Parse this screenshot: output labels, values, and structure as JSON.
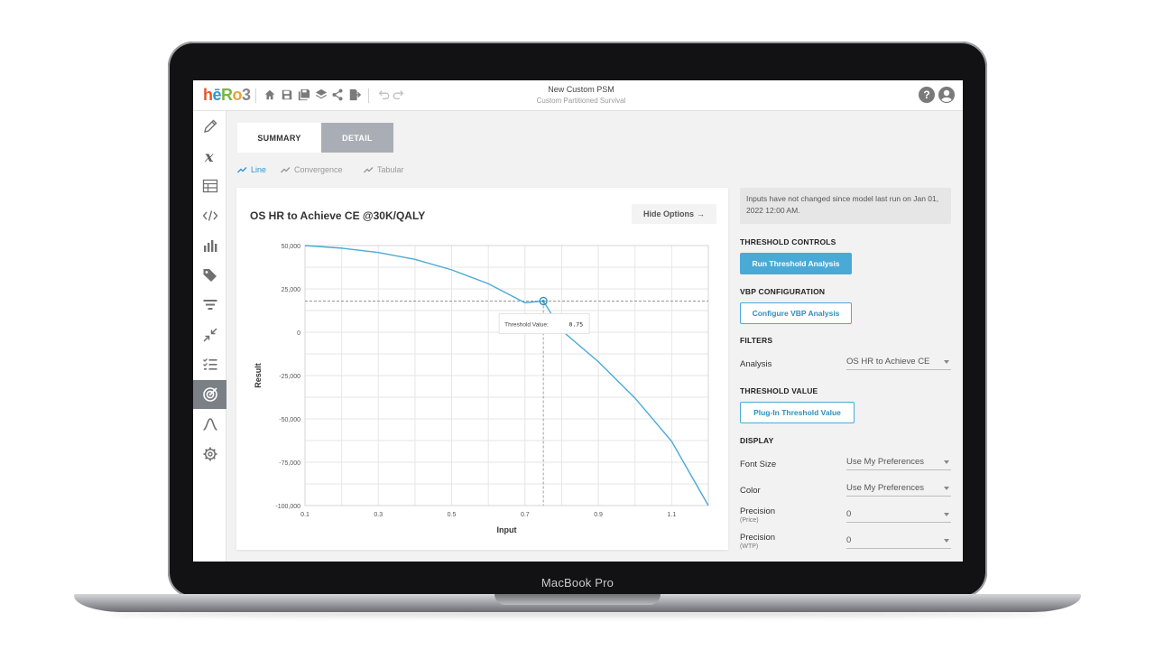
{
  "device": {
    "label": "MacBook Pro"
  },
  "app": {
    "logo": {
      "h": "h",
      "e": "ē",
      "r": "R",
      "o": "o",
      "three": "3"
    },
    "title": "New Custom PSM",
    "subtitle": "Custom Partitioned Survival",
    "toolbar_icons": [
      "home-icon",
      "save-icon",
      "save-as-icon",
      "layers-icon",
      "share-icon",
      "export-icon",
      "undo-icon",
      "redo-icon"
    ],
    "header_icons": [
      "help-icon",
      "user-icon"
    ],
    "help_glyph": "?"
  },
  "sidebar": {
    "items": [
      {
        "icon": "pencil-icon",
        "active": false
      },
      {
        "icon": "variable-x-icon",
        "active": false
      },
      {
        "icon": "table-icon",
        "active": false
      },
      {
        "icon": "code-icon",
        "active": false
      },
      {
        "icon": "bar-chart-icon",
        "active": false
      },
      {
        "icon": "tags-icon",
        "active": false
      },
      {
        "icon": "filter-icon",
        "active": false
      },
      {
        "icon": "compress-icon",
        "active": false
      },
      {
        "icon": "checklist-icon",
        "active": false
      },
      {
        "icon": "target-icon",
        "active": true
      },
      {
        "icon": "curve-icon",
        "active": false
      },
      {
        "icon": "gear-icon",
        "active": false
      }
    ]
  },
  "tabs": {
    "summary": "SUMMARY",
    "detail": "DETAIL",
    "active": "summary"
  },
  "subtabs": [
    {
      "label": "Line",
      "active": true
    },
    {
      "label": "Convergence",
      "active": false
    },
    {
      "label": "Tabular",
      "active": false
    }
  ],
  "card": {
    "title": "OS HR to Achieve CE @30K/QALY",
    "hide_options": "Hide Options",
    "hide_arrow": "→"
  },
  "chart_data": {
    "type": "line",
    "title": "OS HR to Achieve CE @30K/QALY",
    "xlabel": "Input",
    "ylabel": "Result",
    "xlim": [
      0.1,
      1.2
    ],
    "ylim": [
      -100000,
      50000
    ],
    "x_ticks": [
      0.1,
      0.3,
      0.5,
      0.7,
      0.9,
      1.1
    ],
    "x_tick_labels": [
      "0.1",
      "0.3",
      "0.5",
      "0.7",
      "0.9",
      "1.1"
    ],
    "y_ticks": [
      50000,
      25000,
      0,
      -25000,
      -50000,
      -75000,
      -100000
    ],
    "y_tick_labels": [
      "50,000",
      "25,000",
      "0",
      "-25,000",
      "-50,000",
      "-75,000",
      "-100,000"
    ],
    "grid": true,
    "series": [
      {
        "color": "#4aaad6",
        "x": [
          0.1,
          0.2,
          0.3,
          0.4,
          0.5,
          0.6,
          0.7,
          0.75,
          0.8,
          0.9,
          1.0,
          1.1,
          1.2
        ],
        "y": [
          50000,
          48500,
          46000,
          42000,
          36000,
          28000,
          17000,
          18000,
          1000,
          -17000,
          -38000,
          -63000,
          -100000
        ]
      }
    ],
    "threshold": {
      "label": "Threshold Value:",
      "value": "0.75",
      "x": 0.75,
      "y": 18000
    }
  },
  "panel": {
    "status": "Inputs have not changed since model last run on Jan 01, 2022 12:00 AM.",
    "threshold_controls": {
      "heading": "THRESHOLD CONTROLS",
      "button": "Run Threshold Analysis"
    },
    "vbp": {
      "heading": "VBP CONFIGURATION",
      "button": "Configure VBP Analysis"
    },
    "filters": {
      "heading": "FILTERS",
      "analysis_label": "Analysis",
      "analysis_value": "OS HR to Achieve CE"
    },
    "threshold_value": {
      "heading": "THRESHOLD VALUE",
      "button": "Plug-In Threshold Value"
    },
    "display": {
      "heading": "DISPLAY",
      "font_size_label": "Font Size",
      "font_size_value": "Use My Preferences",
      "color_label": "Color",
      "color_value": "Use My Preferences",
      "precision_price_label": "Precision",
      "precision_price_sub": "(Price)",
      "precision_price_value": "0",
      "precision_wtp_label": "Precision",
      "precision_wtp_sub": "(WTP)",
      "precision_wtp_value": "0"
    }
  },
  "colors": {
    "accent": "#4aaad6",
    "sidebar_active": "#7b7f86",
    "detail_tab": "#a9aeb6"
  }
}
